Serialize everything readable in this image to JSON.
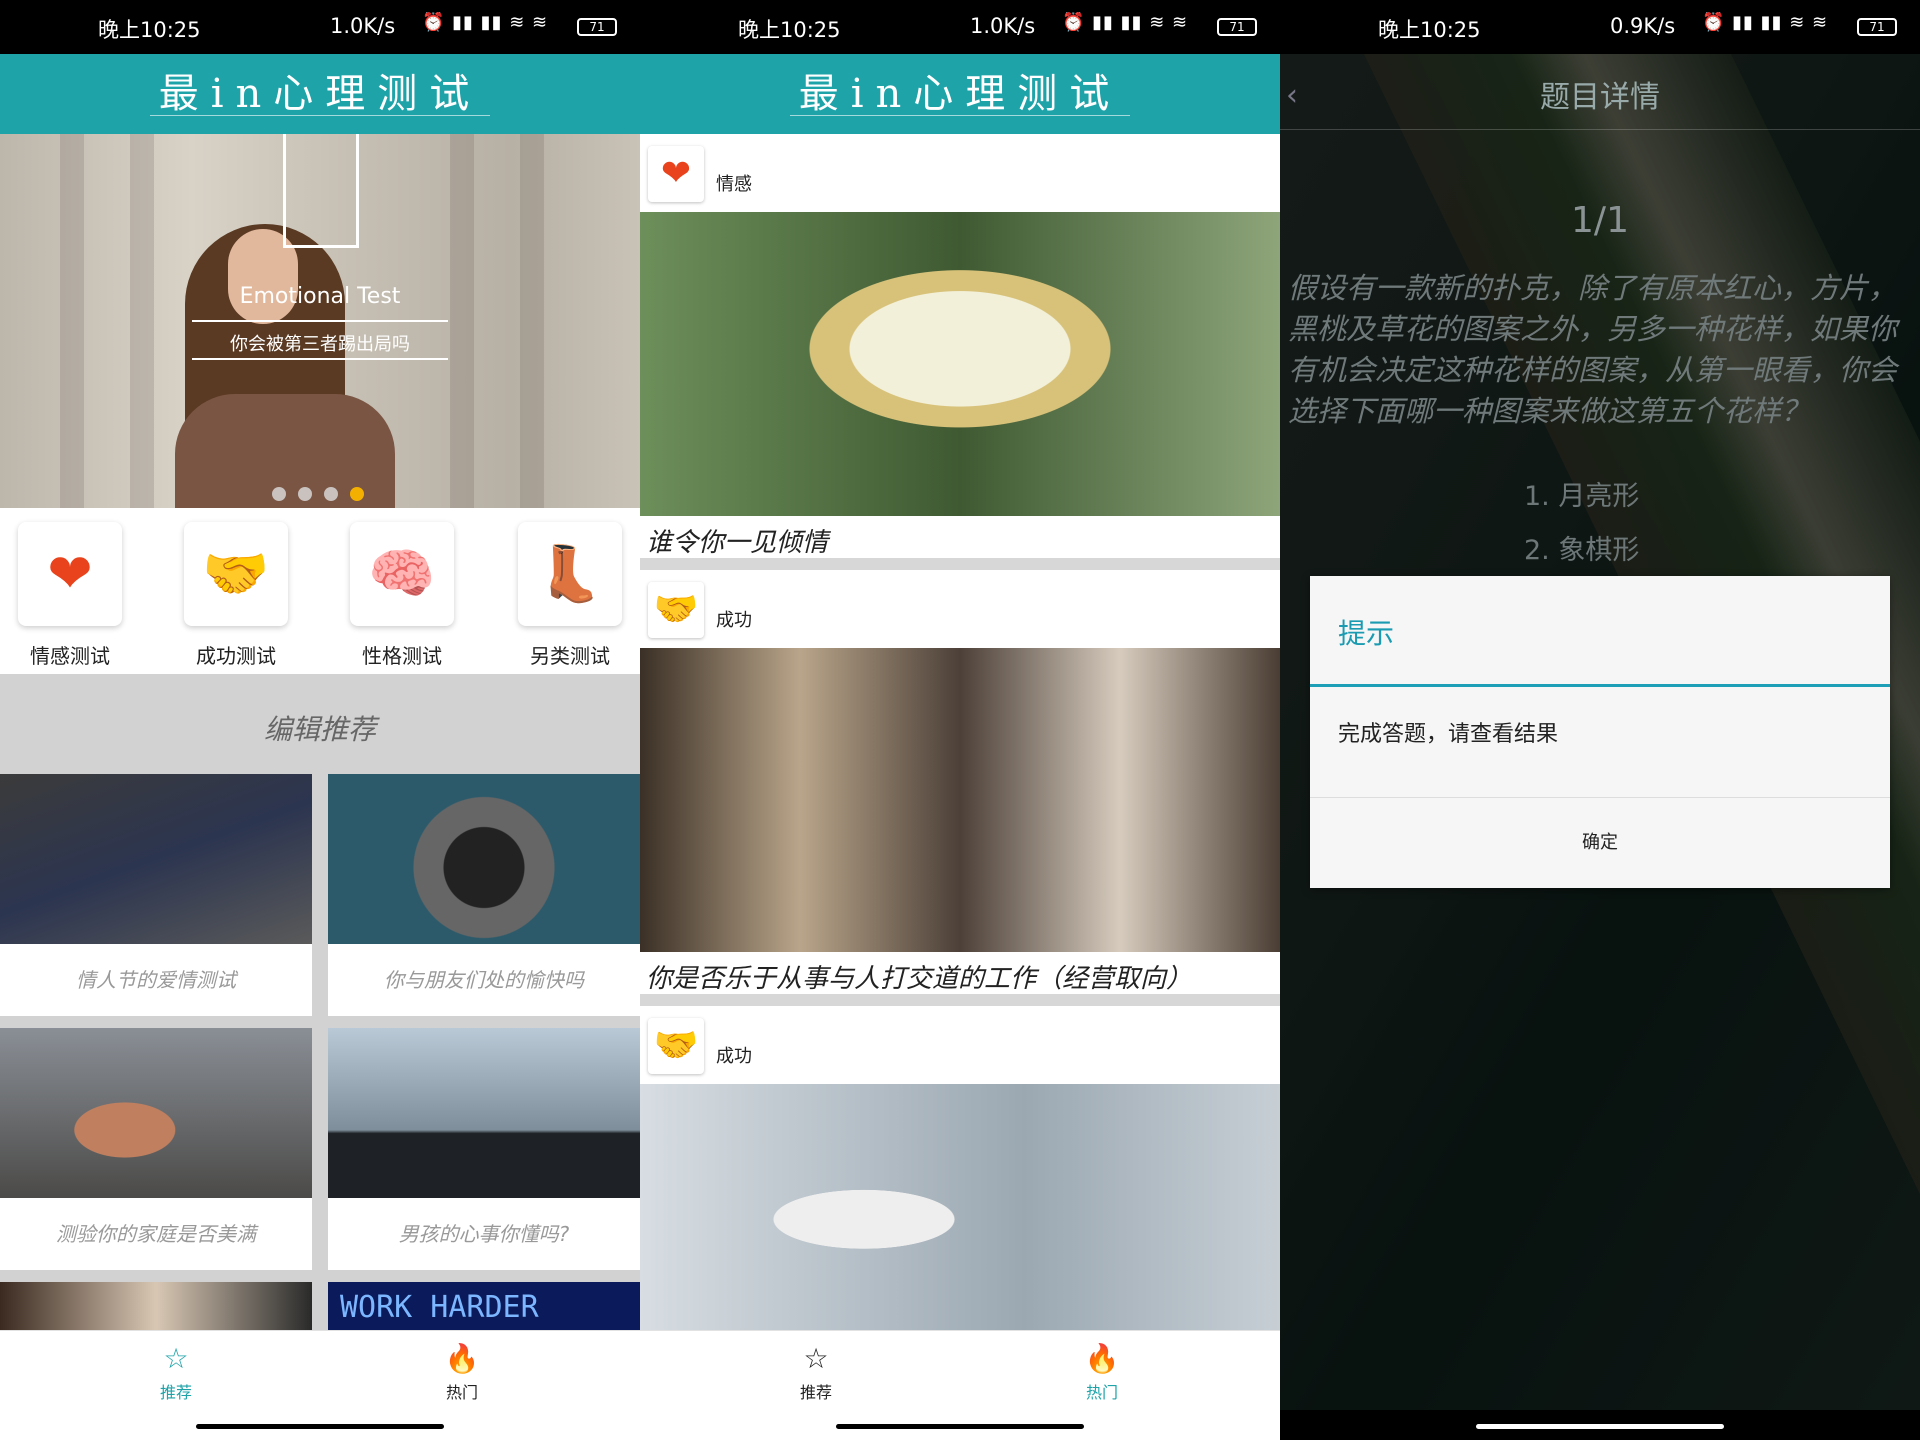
{
  "status": [
    {
      "time": "晚上10:25",
      "speed": "1.0K/s",
      "battery": "71"
    },
    {
      "time": "晚上10:25",
      "speed": "1.0K/s",
      "battery": "71"
    },
    {
      "time": "晚上10:25",
      "speed": "0.9K/s",
      "battery": "71"
    }
  ],
  "app_title": "最in心理测试",
  "home": {
    "banner": {
      "title": "Emotional Test",
      "subtitle": "你会被第三者踢出局吗",
      "active_dot": 4,
      "dot_count": 4
    },
    "categories": [
      {
        "label": "情感测试",
        "icon": "heart-icon"
      },
      {
        "label": "成功测试",
        "icon": "handshake-icon"
      },
      {
        "label": "性格测试",
        "icon": "brain-icon"
      },
      {
        "label": "另类测试",
        "icon": "jester-shoe-icon"
      }
    ],
    "section_title": "编辑推荐",
    "tiles": [
      {
        "caption": "情人节的爱情测试"
      },
      {
        "caption": "你与朋友们处的愉快吗"
      },
      {
        "caption": "测验你的家庭是否美满"
      },
      {
        "caption": "男孩的心事你懂吗?"
      },
      {
        "caption": ""
      },
      {
        "caption": "WORK HARDER"
      }
    ]
  },
  "feed": {
    "cards": [
      {
        "category": "情感",
        "icon": "heart-icon",
        "title": "谁令你一见倾情"
      },
      {
        "category": "成功",
        "icon": "handshake-icon",
        "title": "你是否乐于从事与人打交道的工作（经营取向）"
      },
      {
        "category": "成功",
        "icon": "handshake-icon",
        "title": ""
      }
    ]
  },
  "tabs": [
    {
      "label": "推荐",
      "icon": "bookmark-star-icon"
    },
    {
      "label": "热门",
      "icon": "hot-icon"
    }
  ],
  "detail": {
    "title": "题目详情",
    "progress": "1/1",
    "question": "假设有一款新的扑克，除了有原本红心，方片，黑桃及草花的图案之外，另多一种花样，如果你有机会决定这种花样的图案，从第一眼看，你会选择下面哪一种图案来做这第五个花样？",
    "options": [
      "1. 月亮形",
      "2. 象棋形"
    ],
    "dialog": {
      "title": "提示",
      "message": "完成答题，请查看结果",
      "button": "确定"
    }
  }
}
